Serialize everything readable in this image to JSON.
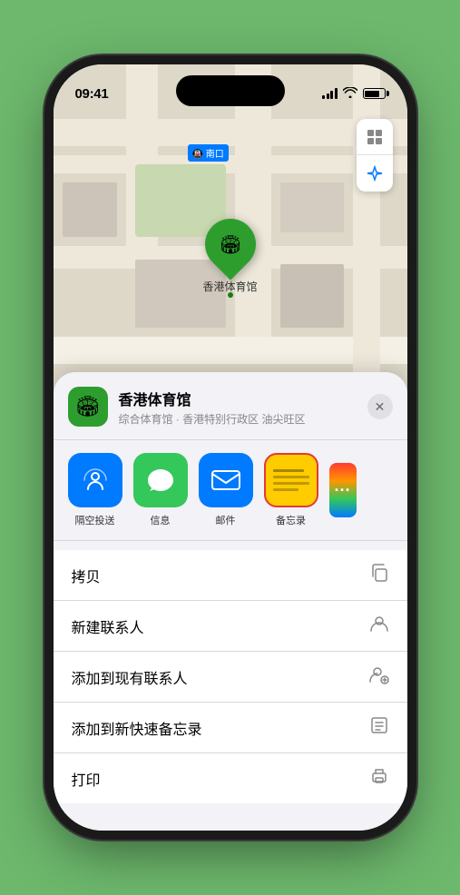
{
  "status": {
    "time": "09:41",
    "location_arrow": "▲"
  },
  "map": {
    "label": "南口",
    "label_prefix": "🚇"
  },
  "pin": {
    "label": "香港体育馆",
    "emoji": "🏟"
  },
  "location_card": {
    "name": "香港体育馆",
    "description": "综合体育馆 · 香港特别行政区 油尖旺区",
    "close_label": "✕"
  },
  "share_items": [
    {
      "id": "airdrop",
      "label": "隔空投送"
    },
    {
      "id": "messages",
      "label": "信息"
    },
    {
      "id": "mail",
      "label": "邮件"
    },
    {
      "id": "notes",
      "label": "备忘录"
    }
  ],
  "actions": [
    {
      "label": "拷贝",
      "icon": "copy"
    },
    {
      "label": "新建联系人",
      "icon": "person"
    },
    {
      "label": "添加到现有联系人",
      "icon": "person-add"
    },
    {
      "label": "添加到新快速备忘录",
      "icon": "note"
    },
    {
      "label": "打印",
      "icon": "print"
    }
  ]
}
